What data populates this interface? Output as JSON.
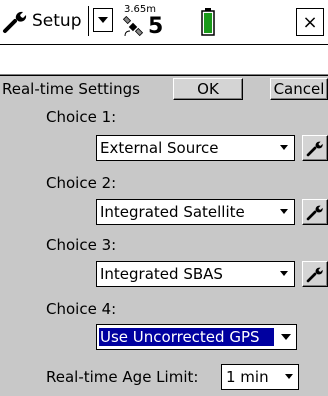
{
  "titlebar": {
    "app_label": "Setup",
    "altitude": "3.65m",
    "satellite_count": "5",
    "close_label": "×"
  },
  "header": {
    "title": "Real-time Settings",
    "ok_label": "OK",
    "cancel_label": "Cancel"
  },
  "choices": [
    {
      "label": "Choice 1:",
      "value": "External Source",
      "has_config": true
    },
    {
      "label": "Choice 2:",
      "value": "Integrated Satellite",
      "has_config": true
    },
    {
      "label": "Choice 3:",
      "value": "Integrated SBAS",
      "has_config": true
    },
    {
      "label": "Choice 4:",
      "value": "Use Uncorrected GPS",
      "has_config": false,
      "selected": true
    }
  ],
  "age_limit": {
    "label": "Real-time Age Limit:",
    "value": "1 min"
  },
  "colors": {
    "panel": "#c8c8c8",
    "selection": "#0000a0",
    "battery": "#1a9a1a"
  },
  "icons": {
    "wrench": "wrench-icon",
    "dropdown": "dropdown-arrow-icon",
    "satellite": "satellite-icon",
    "battery": "battery-icon"
  }
}
